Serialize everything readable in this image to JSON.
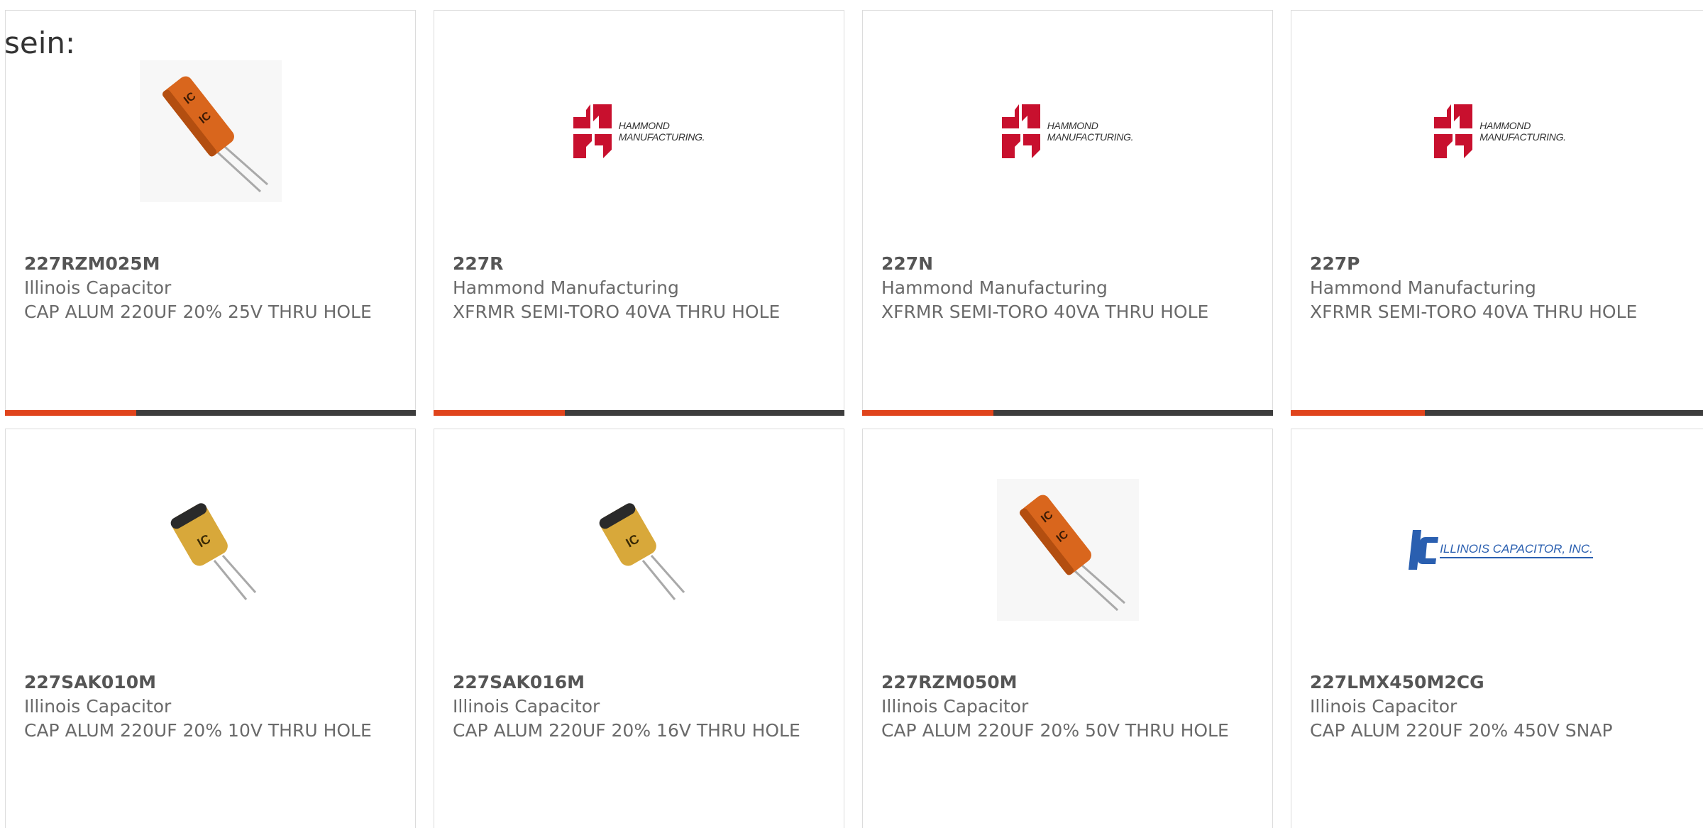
{
  "intro_text": "sein:",
  "colors": {
    "progress_fill": "#e0441c",
    "progress_track": "#3d3d3d",
    "capacitor_orange": "#d9661d",
    "capacitor_gold": "#d8a83a",
    "hammond_red": "#c8102e",
    "ic_blue": "#2a5fb0"
  },
  "logos": {
    "hammond": {
      "line1": "HAMMOND",
      "line2": "MANUFACTURING."
    },
    "illinois": {
      "mark": "IC",
      "text": "ILLINOIS CAPACITOR, INC."
    }
  },
  "products": [
    {
      "image": "orange-capacitor",
      "part_number": "227RZM025M",
      "manufacturer": "Illinois Capacitor",
      "description": "CAP ALUM 220UF 20% 25V THRU HOLE",
      "progress": 0.32
    },
    {
      "image": "hammond-logo",
      "part_number": "227R",
      "manufacturer": "Hammond Manufacturing",
      "description": "XFRMR SEMI-TORO 40VA THRU HOLE",
      "progress": 0.32
    },
    {
      "image": "hammond-logo",
      "part_number": "227N",
      "manufacturer": "Hammond Manufacturing",
      "description": "XFRMR SEMI-TORO 40VA THRU HOLE",
      "progress": 0.32
    },
    {
      "image": "hammond-logo",
      "part_number": "227P",
      "manufacturer": "Hammond Manufacturing",
      "description": "XFRMR SEMI-TORO 40VA THRU HOLE",
      "progress": 0.32
    },
    {
      "image": "gold-capacitor",
      "part_number": "227SAK010M",
      "manufacturer": "Illinois Capacitor",
      "description": "CAP ALUM 220UF 20% 10V THRU HOLE"
    },
    {
      "image": "gold-capacitor",
      "part_number": "227SAK016M",
      "manufacturer": "Illinois Capacitor",
      "description": "CAP ALUM 220UF 20% 16V THRU HOLE"
    },
    {
      "image": "orange-capacitor",
      "part_number": "227RZM050M",
      "manufacturer": "Illinois Capacitor",
      "description": "CAP ALUM 220UF 20% 50V THRU HOLE"
    },
    {
      "image": "illinois-capacitor-logo",
      "part_number": "227LMX450M2CG",
      "manufacturer": "Illinois Capacitor",
      "description": "CAP ALUM 220UF 20% 450V SNAP"
    }
  ]
}
